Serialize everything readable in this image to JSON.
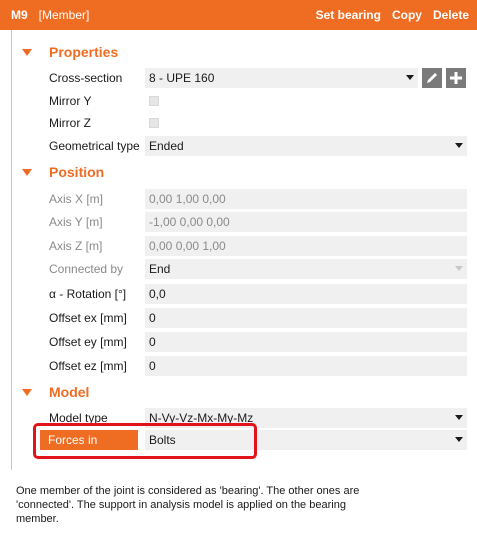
{
  "header": {
    "id": "M9",
    "type": "[Member]",
    "actions": [
      "Set bearing",
      "Copy",
      "Delete"
    ]
  },
  "colors": {
    "accent": "#ef6c23",
    "highlight": "#e0141a",
    "field_bg": "#f0f0f0"
  },
  "sections": {
    "properties": "Properties",
    "position": "Position",
    "model": "Model"
  },
  "properties": {
    "cross_section": {
      "label": "Cross-section",
      "value": "8 - UPE 160"
    },
    "mirror_y": {
      "label": "Mirror Y",
      "checked": false
    },
    "mirror_z": {
      "label": "Mirror Z",
      "checked": false
    },
    "geometrical_type": {
      "label": "Geometrical type",
      "value": "Ended"
    }
  },
  "position": {
    "axis_x": {
      "label": "Axis X [m]",
      "value": "0,00 1,00 0,00"
    },
    "axis_y": {
      "label": "Axis Y [m]",
      "value": "-1,00 0,00 0,00"
    },
    "axis_z": {
      "label": "Axis Z [m]",
      "value": "0,00 0,00 1,00"
    },
    "connected_by": {
      "label": "Connected by",
      "value": "End"
    },
    "rotation": {
      "label": "α - Rotation [°]",
      "value": "0,0"
    },
    "offset_ex": {
      "label": "Offset ex [mm]",
      "value": "0"
    },
    "offset_ey": {
      "label": "Offset ey [mm]",
      "value": "0"
    },
    "offset_ez": {
      "label": "Offset ez [mm]",
      "value": "0"
    }
  },
  "model": {
    "model_type": {
      "label": "Model type",
      "value": "N-Vy-Vz-Mx-My-Mz"
    },
    "forces_in": {
      "label": "Forces in",
      "value": "Bolts"
    }
  },
  "icons": {
    "edit": "pencil-icon",
    "add": "plus-icon"
  },
  "info_text": "One member of the joint is considered as 'bearing'. The other ones are 'connected'. The support in analysis model is applied on the bearing member."
}
